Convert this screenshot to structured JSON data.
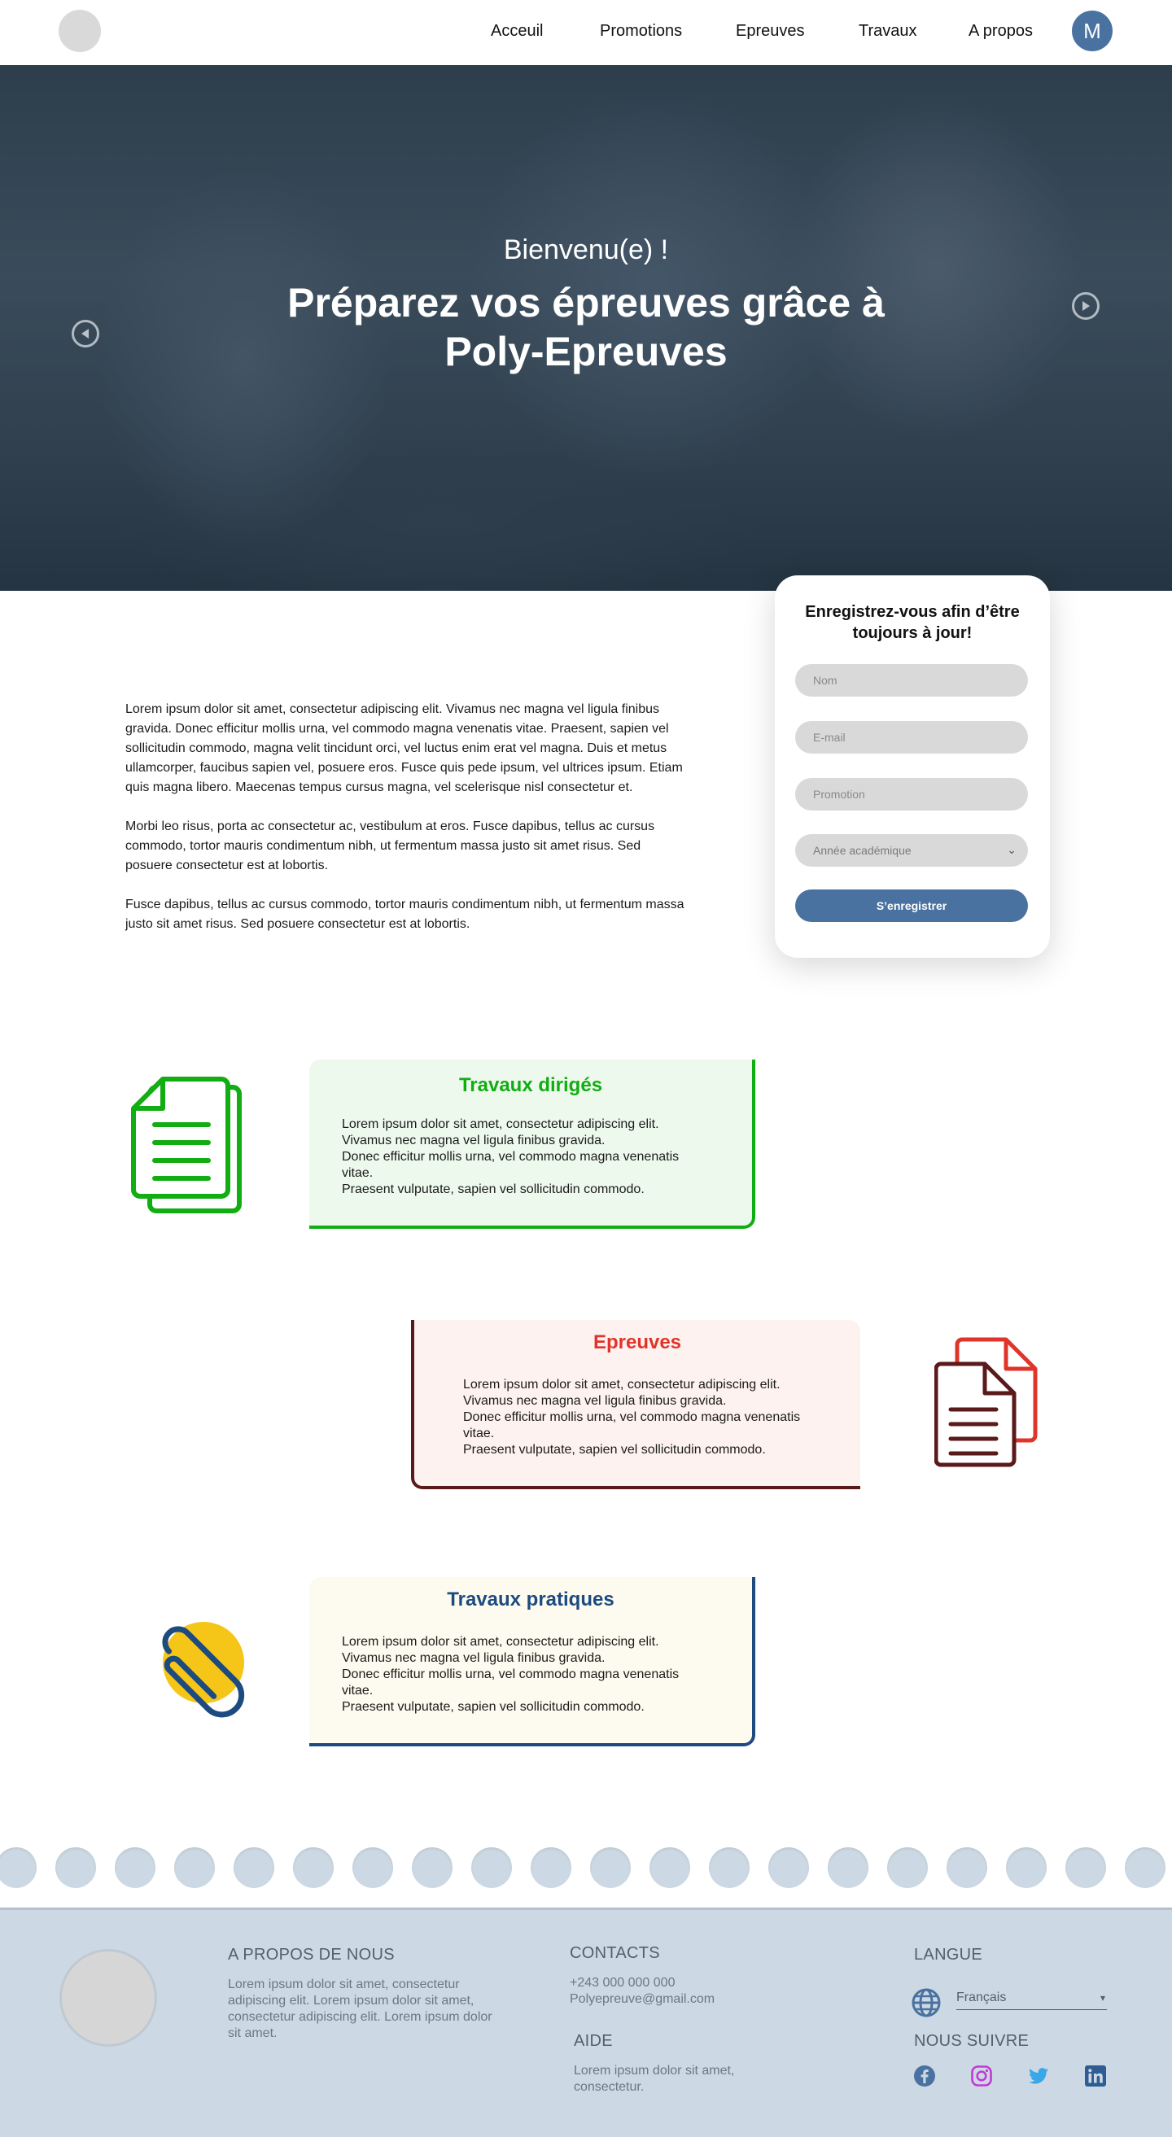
{
  "nav": {
    "links": [
      "Acceuil",
      "Promotions",
      "Epreuves",
      "Travaux",
      "A propos"
    ],
    "avatar_initial": "M"
  },
  "hero": {
    "subtitle": "Bienvenu(e) !",
    "title": "Préparez vos épreuves grâce à Poly-Epreuves"
  },
  "intro": {
    "paragraphs": [
      "Lorem ipsum dolor sit amet, consectetur adipiscing elit. Vivamus nec magna vel ligula finibus gravida. Donec efficitur mollis urna, vel commodo magna venenatis vitae. Praesent, sapien vel sollicitudin commodo, magna velit tincidunt orci, vel luctus enim erat vel magna. Duis et metus ullamcorper, faucibus sapien vel, posuere eros. Fusce quis pede ipsum, vel ultrices ipsum. Etiam quis magna libero. Maecenas tempus cursus magna, vel scelerisque nisl consectetur et.",
      "Morbi leo risus, porta ac consectetur ac, vestibulum at eros. Fusce dapibus, tellus ac cursus commodo, tortor mauris condimentum nibh, ut fermentum massa justo sit amet risus. Sed posuere consectetur est at lobortis.",
      "Fusce dapibus, tellus ac cursus commodo, tortor mauris condimentum nibh, ut fermentum massa justo sit amet risus. Sed posuere consectetur est at lobortis."
    ]
  },
  "register": {
    "title": "Enregistrez-vous afin d’être toujours à jour!",
    "name_placeholder": "Nom",
    "email_placeholder": "E-mail",
    "promotion_placeholder": "Promotion",
    "year_placeholder": "Année académique",
    "submit_label": "S’enregistrer"
  },
  "features": {
    "td": {
      "title": "Travaux dirigés",
      "lines": [
        "Lorem ipsum dolor sit amet, consectetur adipiscing elit.",
        "Vivamus nec magna vel ligula finibus gravida.",
        "Donec efficitur mollis urna, vel commodo magna venenatis",
        "vitae.",
        "Praesent vulputate, sapien vel sollicitudin commodo."
      ]
    },
    "ep": {
      "title": "Epreuves",
      "lines": [
        "Lorem ipsum dolor sit amet, consectetur adipiscing elit.",
        "Vivamus nec magna vel ligula finibus gravida.",
        "Donec efficitur mollis urna, vel commodo magna venenatis",
        "vitae.",
        "Praesent vulputate, sapien vel sollicitudin commodo."
      ]
    },
    "tp": {
      "title": "Travaux pratiques",
      "lines": [
        "Lorem ipsum dolor sit amet, consectetur adipiscing elit.",
        "Vivamus nec magna vel ligula finibus gravida.",
        "Donec efficitur mollis urna, vel commodo magna venenatis",
        "vitae.",
        "Praesent vulputate, sapien vel sollicitudin commodo."
      ]
    }
  },
  "footer": {
    "about_heading": "A PROPOS DE NOUS",
    "about_text": "Lorem ipsum dolor sit amet, consectetur adipiscing elit. Lorem ipsum dolor sit amet, consectetur adipiscing elit. Lorem ipsum dolor sit amet.",
    "contacts_heading": "CONTACTS",
    "phone": "+243 000 000 000",
    "email": "Polyepreuve@gmail.com",
    "help_heading": "AIDE",
    "help_text": "Lorem ipsum dolor sit amet, consectetur.",
    "language_heading": "LANGUE",
    "language_value": "Français",
    "follow_heading": "NOUS SUIVRE",
    "social_icons": [
      "facebook-icon",
      "instagram-icon",
      "twitter-icon",
      "linkedin-icon"
    ]
  },
  "colors": {
    "brand_blue": "#4a72a0",
    "td_green": "#12ad12",
    "ep_red": "#e0342a",
    "ep_dark": "#5a1a1a",
    "tp_navy": "#1d4b80",
    "tp_yellow": "#f5c518",
    "footer_bg": "#ccd9e4"
  }
}
